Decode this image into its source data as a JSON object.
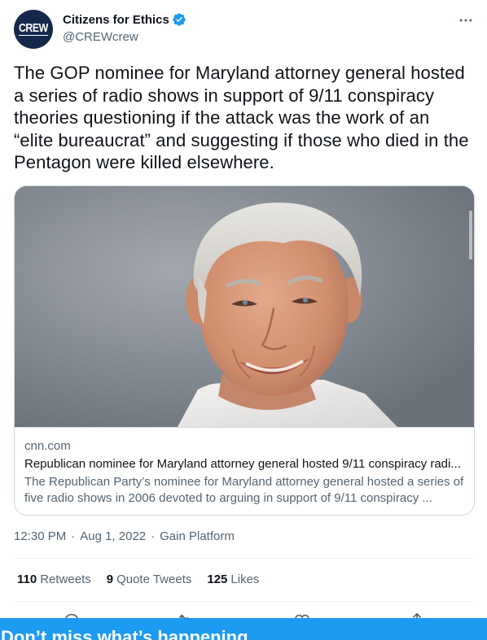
{
  "account": {
    "display_name": "Citizens for Ethics",
    "handle": "@CREWcrew",
    "avatar_text": "CREW",
    "verified": true
  },
  "tweet": {
    "text": "The GOP nominee for Maryland attorney general hosted a series of radio shows in support of 9/11 conspiracy theories questioning if the attack was the work of an “elite bureaucrat” and suggesting if those who died in the Pentagon were killed elsewhere.",
    "time": "12:30 PM",
    "date": "Aug 1, 2022",
    "source": "Gain Platform",
    "separator": "·"
  },
  "card": {
    "image_alt": "Photo of a smiling man with white hair",
    "domain": "cnn.com",
    "title": "Republican nominee for Maryland attorney general hosted 9/11 conspiracy radi...",
    "description": "The Republican Party’s nominee for Maryland attorney general hosted a series of five radio shows in 2006 devoted to arguing in support of 9/11 conspiracy ..."
  },
  "stats": {
    "retweets_count": "110",
    "retweets_label": "Retweets",
    "quotes_count": "9",
    "quotes_label": "Quote Tweets",
    "likes_count": "125",
    "likes_label": "Likes"
  },
  "actions": [
    "reply-icon",
    "retweet-icon",
    "like-icon",
    "share-icon"
  ],
  "banner": {
    "text": "Don’t miss what’s happening"
  },
  "colors": {
    "accent": "#1d9bf0",
    "text_primary": "#0f1419",
    "text_secondary": "#536471",
    "border": "#cfd9de",
    "avatar_bg": "#15284b"
  }
}
